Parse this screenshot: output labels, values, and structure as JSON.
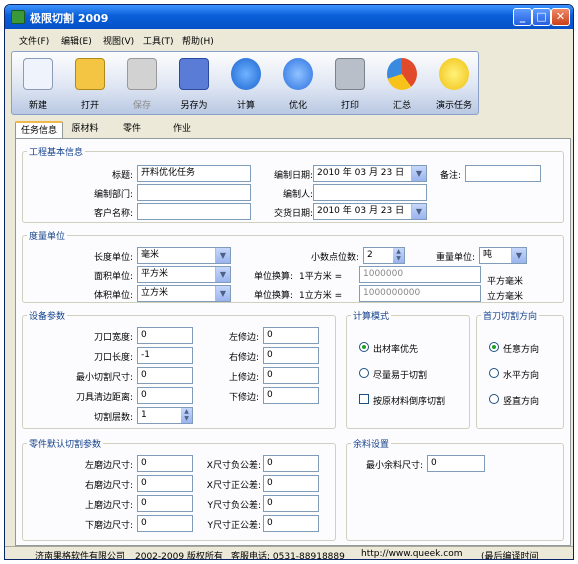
{
  "window": {
    "title": "极限切割 2009",
    "min": "_",
    "max": "□",
    "close": "✕"
  },
  "menu": [
    "文件(F)",
    "编辑(E)",
    "视图(V)",
    "工具(T)",
    "帮助(H)"
  ],
  "toolbar": [
    {
      "label": "新建",
      "icon": "new-file-icon",
      "color": "#e6eefc"
    },
    {
      "label": "打开",
      "icon": "open-folder-icon",
      "color": "#f4c542"
    },
    {
      "label": "保存",
      "icon": "save-icon",
      "color": "#c8c8c8"
    },
    {
      "label": "另存为",
      "icon": "save-as-icon",
      "color": "#5a7bd6"
    },
    {
      "label": "计算",
      "icon": "play-icon",
      "color": "#2a79e0"
    },
    {
      "label": "优化",
      "icon": "eject-icon",
      "color": "#3a7ee6"
    },
    {
      "label": "打印",
      "icon": "printer-icon",
      "color": "#9aa3ad"
    },
    {
      "label": "汇总",
      "icon": "pie-chart-icon",
      "color": "#e04a2a"
    },
    {
      "label": "演示任务",
      "icon": "smiley-icon",
      "color": "#f7d21a"
    }
  ],
  "tabs": [
    "任务信息",
    "原材料",
    "零件",
    "作业"
  ],
  "project": {
    "legend": "工程基本信息",
    "title_label": "标题:",
    "title_value": "开料优化任务",
    "date_label": "编制日期:",
    "date_value": "2010 年 03 月 23 日",
    "note_label": "备注:",
    "dept_label": "编制部门:",
    "author_label": "编制人:",
    "client_label": "客户名称:",
    "delivery_label": "交货日期:",
    "delivery_value": "2010 年 03 月 23 日"
  },
  "units": {
    "legend": "度量单位",
    "length_label": "长度单位:",
    "length_value": "毫米",
    "decimals_label": "小数点位数:",
    "decimals_value": "2",
    "weight_label": "重量单位:",
    "weight_value": "吨",
    "area_label": "面积单位:",
    "area_value": "平方米",
    "conv1_label": "单位换算:",
    "conv1_mid": "1平方米 =",
    "conv1_value": "1000000",
    "conv1_unit": "平方毫米",
    "volume_label": "体积单位:",
    "volume_value": "立方米",
    "conv2_label": "单位换算:",
    "conv2_mid": "1立方米 =",
    "conv2_value": "1000000000",
    "conv2_unit": "立方毫米"
  },
  "device": {
    "legend": "设备参数",
    "kerf_w_label": "刀口宽度:",
    "kerf_w_value": "0",
    "left_trim_label": "左修边:",
    "left_trim_value": "0",
    "kerf_l_label": "刀口长度:",
    "kerf_l_value": "-1",
    "right_trim_label": "右修边:",
    "right_trim_value": "0",
    "min_cut_label": "最小切割尺寸:",
    "min_cut_value": "0",
    "top_trim_label": "上修边:",
    "top_trim_value": "0",
    "clear_label": "刀具清边距离:",
    "clear_value": "0",
    "bottom_trim_label": "下修边:",
    "bottom_trim_value": "0",
    "layers_label": "切割层数:",
    "layers_value": "1"
  },
  "calc_mode": {
    "legend": "计算模式",
    "opt1": "出材率优先",
    "opt2": "尽量易于切割",
    "opt3": "按原材料倒序切割"
  },
  "first_cut": {
    "legend": "首刀切割方向",
    "opt1": "任意方向",
    "opt2": "水平方向",
    "opt3": "竖直方向"
  },
  "part_params": {
    "legend": "零件默认切割参数",
    "left_label": "左磨边尺寸:",
    "left_value": "0",
    "x_neg_label": "X尺寸负公差:",
    "x_neg_value": "0",
    "right_label": "右磨边尺寸:",
    "right_value": "0",
    "x_pos_label": "X尺寸正公差:",
    "x_pos_value": "0",
    "top_label": "上磨边尺寸:",
    "top_value": "0",
    "y_neg_label": "Y尺寸负公差:",
    "y_neg_value": "0",
    "bottom_label": "下磨边尺寸:",
    "bottom_value": "0",
    "y_pos_label": "Y尺寸正公差:",
    "y_pos_value": "0"
  },
  "remnant": {
    "legend": "余料设置",
    "min_label": "最小余料尺寸:",
    "min_value": "0"
  },
  "status": {
    "company": "济南果格软件有限公司",
    "copyright": "2002-2009 版权所有",
    "phone": "客服电话: 0531-88918889",
    "url": "http://www.queek.com",
    "build": "(最后编译时间"
  }
}
